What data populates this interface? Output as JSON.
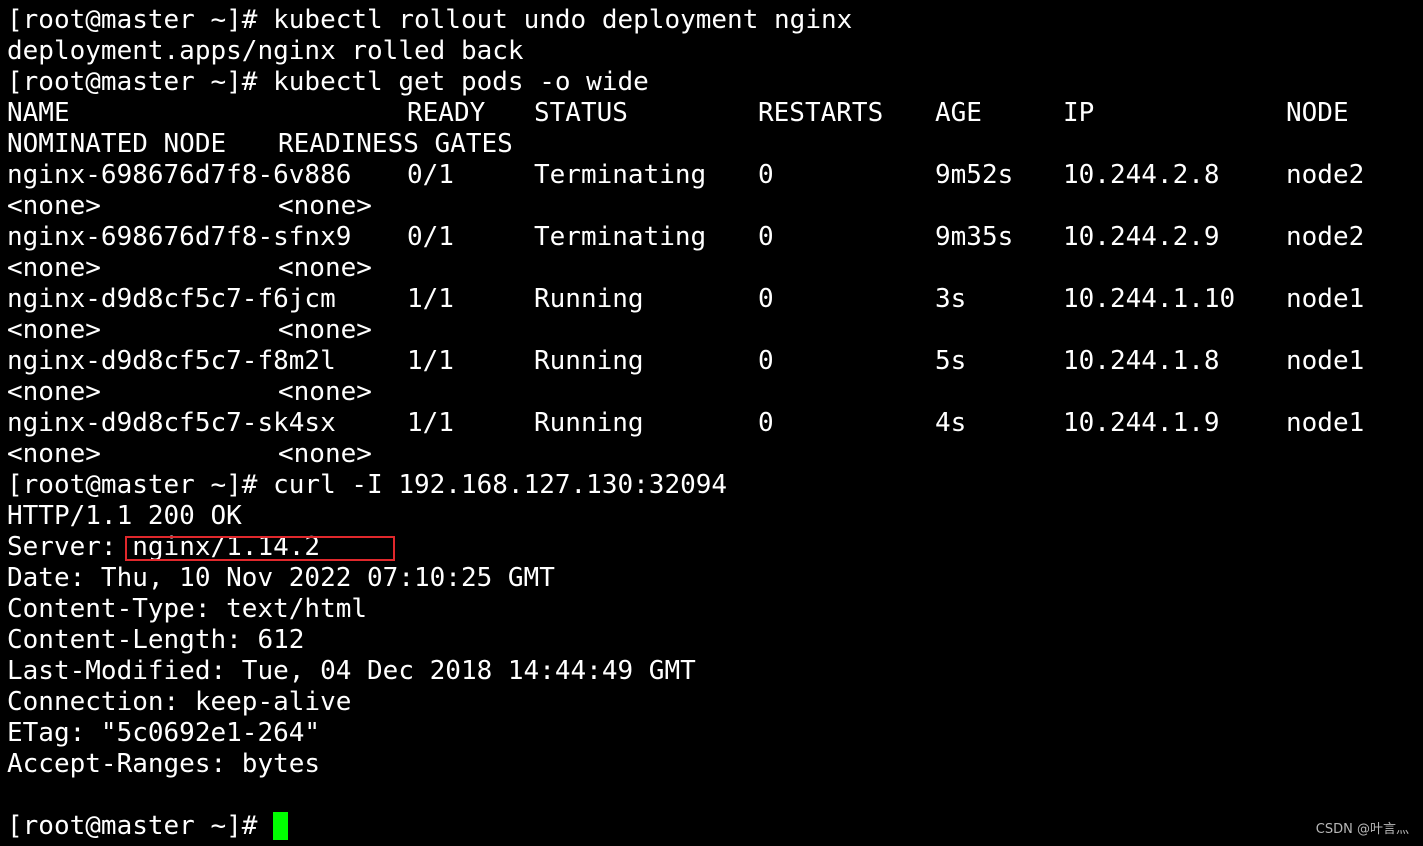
{
  "terminal": {
    "prompt": "[root@master ~]# ",
    "commands": {
      "rollout": "kubectl rollout undo deployment nginx",
      "get_pods": "kubectl get pods -o wide",
      "curl": "curl -I 192.168.127.130:32094"
    },
    "rollout_output": "deployment.apps/nginx rolled back",
    "pods_table": {
      "headers": [
        "NAME",
        "READY",
        "STATUS",
        "RESTARTS",
        "AGE",
        "IP",
        "NODE"
      ],
      "headers2": [
        "NOMINATED NODE",
        "READINESS GATES"
      ],
      "rows": [
        {
          "name": "nginx-698676d7f8-6v886",
          "ready": "0/1",
          "status": "Terminating",
          "restarts": "0",
          "age": "9m52s",
          "ip": "10.244.2.8",
          "node": "node2",
          "nominated": "<none>",
          "gates": "<none>"
        },
        {
          "name": "nginx-698676d7f8-sfnx9",
          "ready": "0/1",
          "status": "Terminating",
          "restarts": "0",
          "age": "9m35s",
          "ip": "10.244.2.9",
          "node": "node2",
          "nominated": "<none>",
          "gates": "<none>"
        },
        {
          "name": "nginx-d9d8cf5c7-f6jcm",
          "ready": "1/1",
          "status": "Running",
          "restarts": "0",
          "age": "3s",
          "ip": "10.244.1.10",
          "node": "node1",
          "nominated": "<none>",
          "gates": "<none>"
        },
        {
          "name": "nginx-d9d8cf5c7-f8m2l",
          "ready": "1/1",
          "status": "Running",
          "restarts": "0",
          "age": "5s",
          "ip": "10.244.1.8",
          "node": "node1",
          "nominated": "<none>",
          "gates": "<none>"
        },
        {
          "name": "nginx-d9d8cf5c7-sk4sx",
          "ready": "1/1",
          "status": "Running",
          "restarts": "0",
          "age": "4s",
          "ip": "10.244.1.9",
          "node": "node1",
          "nominated": "<none>",
          "gates": "<none>"
        }
      ]
    },
    "http_response": {
      "status_line": "HTTP/1.1 200 OK",
      "server_label": "Server: ",
      "server_value": "nginx/1.14.2",
      "date": "Date: Thu, 10 Nov 2022 07:10:25 GMT",
      "content_type": "Content-Type: text/html",
      "content_length": "Content-Length: 612",
      "last_modified": "Last-Modified: Tue, 04 Dec 2018 14:44:49 GMT",
      "connection": "Connection: keep-alive",
      "etag": "ETag: \"5c0692e1-264\"",
      "accept_ranges": "Accept-Ranges: bytes"
    }
  },
  "watermark": "CSDN @叶言灬",
  "colors": {
    "background": "#000000",
    "text": "#ffffff",
    "cursor": "#00ff00",
    "highlight_box": "#e0282c"
  }
}
